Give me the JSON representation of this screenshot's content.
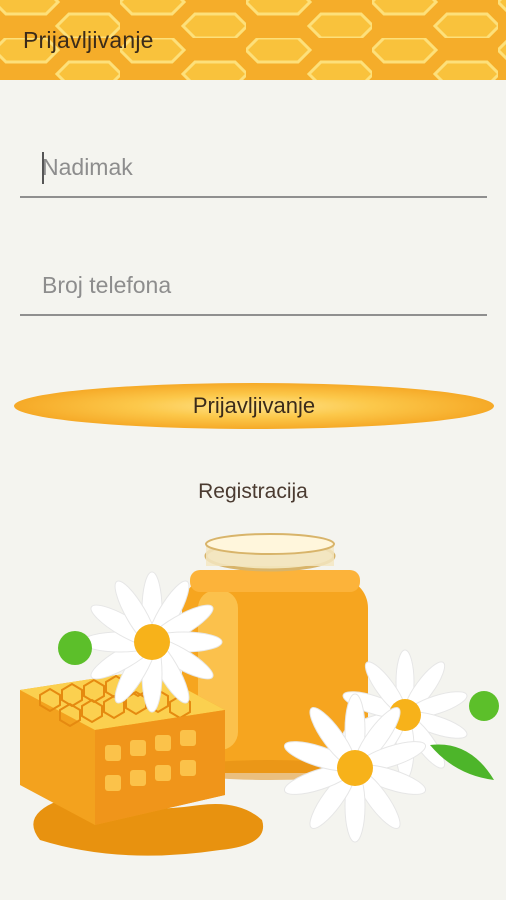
{
  "app_bar": {
    "title": "Prijavljivanje"
  },
  "form": {
    "nickname": {
      "placeholder": "Nadimak",
      "value": ""
    },
    "phone": {
      "placeholder": "Broj telefona",
      "value": ""
    },
    "login_label": "Prijavljivanje",
    "register_label": "Registracija"
  },
  "colors": {
    "honey_orange": "#f5a623",
    "honeycomb_line": "#fbd560",
    "background": "#f4f4ef",
    "text_dark": "#3b2b1a"
  },
  "icons": [
    "honeycomb-pattern",
    "honey-jar",
    "daisy-flower",
    "honeycomb-piece"
  ]
}
